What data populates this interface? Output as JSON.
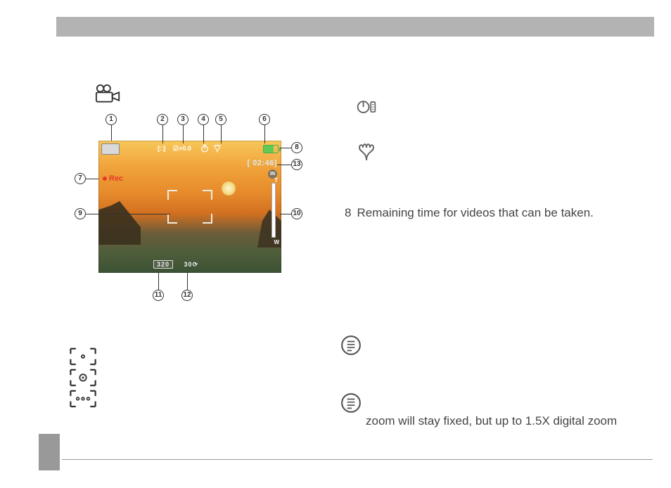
{
  "screen": {
    "ev": "+0.0",
    "ev_symbol": "☑",
    "time_remaining": "[ 02:46]",
    "in": "IN",
    "rec": "Rec",
    "zoom_t": "T",
    "zoom_w": "W",
    "size": "320",
    "fps": "30"
  },
  "legend": {
    "item8_num": "8",
    "item8_text": "Remaining time for videos that can be taken."
  },
  "note2": "zoom will stay fixed, but up to 1.5X digital zoom",
  "callouts": {
    "c1": "1",
    "c2": "2",
    "c3": "3",
    "c4": "4",
    "c5": "5",
    "c6": "6",
    "c7": "7",
    "c8": "8",
    "c9": "9",
    "c10": "10",
    "c11": "11",
    "c12": "12",
    "c13": "13"
  }
}
